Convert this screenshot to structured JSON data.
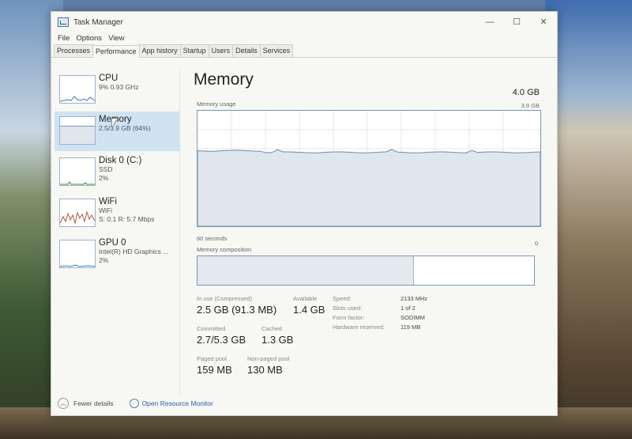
{
  "window": {
    "title": "Task Manager",
    "controls": {
      "minimize": "—",
      "maximize": "☐",
      "close": "✕"
    }
  },
  "menu": [
    "File",
    "Options",
    "View"
  ],
  "tabs": [
    "Processes",
    "Performance",
    "App history",
    "Startup",
    "Users",
    "Details",
    "Services"
  ],
  "active_tab": "Performance",
  "resources": [
    {
      "name": "CPU",
      "line1": "9% 0.93 GHz",
      "line2": ""
    },
    {
      "name": "Memory",
      "line1": "2.5/3.9 GB (64%)",
      "line2": ""
    },
    {
      "name": "Disk 0 (C:)",
      "line1": "SSD",
      "line2": "2%"
    },
    {
      "name": "WiFi",
      "line1": "WiFi",
      "line2": "S: 0.1 R: 5.7 Mbps"
    },
    {
      "name": "GPU 0",
      "line1": "Intel(R) HD Graphics ...",
      "line2": "2%"
    }
  ],
  "selected_resource": "Memory",
  "memory": {
    "title": "Memory",
    "total": "4.0 GB",
    "graph_label": "Memory usage",
    "graph_max": "3.9 GB",
    "graph_time_left": "60 seconds",
    "graph_time_right": "0",
    "composition_label": "Memory composition",
    "usage_fraction": 0.64,
    "stats": {
      "in_use_label": "In use (Compressed)",
      "in_use": "2.5 GB (91.3 MB)",
      "available_label": "Available",
      "available": "1.4 GB",
      "committed_label": "Committed",
      "committed": "2.7/5.3 GB",
      "cached_label": "Cached",
      "cached": "1.3 GB",
      "paged_pool_label": "Paged pool",
      "paged_pool": "159 MB",
      "nonpaged_pool_label": "Non-paged pool",
      "nonpaged_pool": "130 MB"
    },
    "details": {
      "speed_label": "Speed:",
      "speed": "2133 MHz",
      "slots_label": "Slots used:",
      "slots": "1 of 2",
      "form_label": "Form factor:",
      "form": "SODIMM",
      "hw_label": "Hardware reserved:",
      "hw": "119 MB"
    }
  },
  "footer": {
    "fewer_details": "Fewer details",
    "open_rm": "Open Resource Monitor"
  }
}
